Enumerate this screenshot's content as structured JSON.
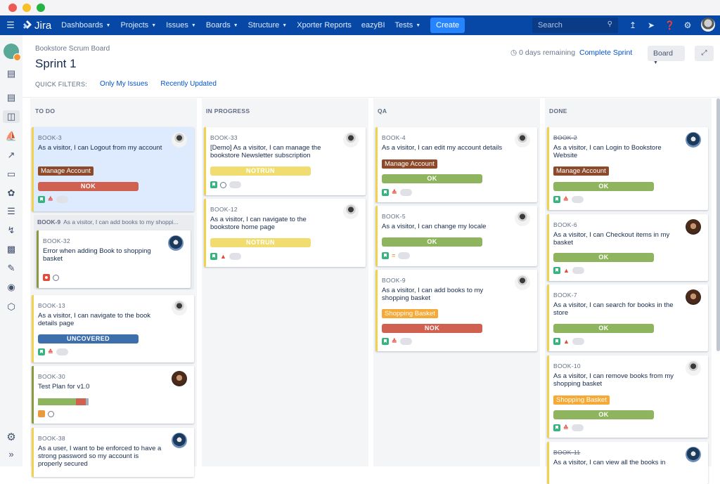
{
  "window": {
    "controls": [
      {
        "name": "close",
        "color": "#ec5a52"
      },
      {
        "name": "minimize",
        "color": "#f5c02a"
      },
      {
        "name": "zoom",
        "color": "#27b244"
      }
    ]
  },
  "topnav": {
    "app_name": "Jira",
    "menu": [
      {
        "label": "Dashboards",
        "dropdown": true
      },
      {
        "label": "Projects",
        "dropdown": true
      },
      {
        "label": "Issues",
        "dropdown": true
      },
      {
        "label": "Boards",
        "dropdown": true
      },
      {
        "label": "Structure",
        "dropdown": true
      },
      {
        "label": "Xporter Reports",
        "dropdown": false
      },
      {
        "label": "eazyBI",
        "dropdown": false
      },
      {
        "label": "Tests",
        "dropdown": true
      }
    ],
    "create_label": "Create",
    "search_placeholder": "Search",
    "icons": [
      "upload-icon",
      "notifications-icon",
      "help-icon",
      "settings-icon",
      "user-avatar"
    ]
  },
  "sidebar": {
    "icons": [
      "project-avatar",
      "backlog-icon",
      "releases-icon",
      "board-icon",
      "deploy-icon",
      "reports-icon",
      "test-monitor-icon",
      "addons-icon",
      "structure-icon",
      "automation-icon",
      "hierarchy-icon",
      "test-plan-icon",
      "archive-icon",
      "component-icon"
    ],
    "bottom_icons": [
      "settings-icon",
      "expand-sidebar-icon"
    ]
  },
  "header": {
    "breadcrumb": "Bookstore Scrum Board",
    "title": "Sprint 1",
    "days_remaining": "0 days remaining",
    "complete_sprint": "Complete Sprint",
    "board_button": "Board",
    "quick_filters_label": "QUICK FILTERS:",
    "quick_filters": [
      "Only My Issues",
      "Recently Updated"
    ]
  },
  "colors": {
    "ok": "#8fb45e",
    "nok": "#d0604f",
    "notrun": "#f1dd6f",
    "uncovered": "#3c6fac",
    "manage_account": "#8c4a2b",
    "shopping_basket": "#f6a935"
  },
  "columns": [
    {
      "title": "TO DO"
    },
    {
      "title": "IN PROGRESS"
    },
    {
      "title": "QA"
    },
    {
      "title": "DONE"
    }
  ],
  "cards": {
    "book3": {
      "key": "BOOK-3",
      "summary": "As a visitor, I can Logout from my account",
      "epic": "Manage Account",
      "status": "NOK"
    },
    "subtask_parent": {
      "key": "BOOK-9",
      "summary": "As a visitor, I can add books to my shoppi..."
    },
    "book32": {
      "key": "BOOK-32",
      "summary": "Error when adding Book to shopping basket"
    },
    "book13": {
      "key": "BOOK-13",
      "summary": "As a visitor, I can navigate to the book details page",
      "status": "UNCOVERED"
    },
    "book30": {
      "key": "BOOK-30",
      "summary": "Test Plan for v1.0",
      "progress": {
        "passed": 0.75,
        "failed": 0.2,
        "other": 0.05
      }
    },
    "book38": {
      "key": "BOOK-38",
      "summary": "As a user, I want to be enforced to have a strong password so my account is properly secured"
    },
    "book33": {
      "key": "BOOK-33",
      "summary": "[Demo] As a visitor, I can manage the bookstore Newsletter subscription",
      "status": "NOTRUN"
    },
    "book12": {
      "key": "BOOK-12",
      "summary": "As a visitor, I can navigate to the bookstore home page",
      "status": "NOTRUN"
    },
    "book4": {
      "key": "BOOK-4",
      "summary": "As a visitor, I can edit my account details",
      "epic": "Manage Account",
      "status": "OK"
    },
    "book5": {
      "key": "BOOK-5",
      "summary": "As a visitor, I can change my locale",
      "status": "OK"
    },
    "book9": {
      "key": "BOOK-9",
      "summary": "As a visitor, I can add books to my shopping basket",
      "epic": "Shopping Basket",
      "status": "NOK"
    },
    "book2": {
      "key": "BOOK-2",
      "summary": "As a visitor, I can Login to Bookstore Website",
      "epic": "Manage Account",
      "status": "OK"
    },
    "book6": {
      "key": "BOOK-6",
      "summary": "As a visitor, I can Checkout items in my basket",
      "status": "OK"
    },
    "book7": {
      "key": "BOOK-7",
      "summary": "As a visitor, I can search for books in the store",
      "status": "OK"
    },
    "book10": {
      "key": "BOOK-10",
      "summary": "As a visitor, I can remove books from my shopping basket",
      "epic": "Shopping Basket",
      "status": "OK"
    },
    "book11": {
      "key": "BOOK-11",
      "summary": "As a visitor, I can view all the books in"
    }
  }
}
